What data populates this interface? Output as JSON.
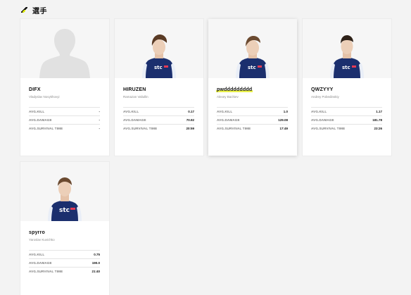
{
  "section": {
    "title": "選手"
  },
  "labels": {
    "kill": "AVG.KILL",
    "damage": "AVG.DAMAGE",
    "survival": "AVG.SURVIVAL TIME"
  },
  "colors": {
    "accent": "#d8e600",
    "jersey": "#1b2f6e",
    "placeholder_silhouette": "#e1e1e1"
  },
  "players": [
    {
      "name": "DIFX",
      "realname": "Vladyslav Novykhovyi",
      "kill": "-",
      "damage": "-",
      "survival": "-",
      "photo": "silhouette-placeholder"
    },
    {
      "name": "HIRUZEN",
      "realname": "Ramazan Valiullin",
      "kill": "0.17",
      "damage": "70.92",
      "survival": "20:59",
      "photo": "player-photo"
    },
    {
      "name": "pwddddddddd",
      "realname": "Alexey Bachiev",
      "kill": "1.0",
      "damage": "129.08",
      "survival": "17:49",
      "photo": "player-photo"
    },
    {
      "name": "QWZYYY",
      "realname": "Andrey Pobedinskiy",
      "kill": "1.17",
      "damage": "181.78",
      "survival": "23:26",
      "photo": "player-photo"
    },
    {
      "name": "spyrro",
      "realname": "Yaroslav Kuvichko",
      "kill": "0.75",
      "damage": "190.0",
      "survival": "21:40",
      "photo": "player-photo"
    }
  ]
}
